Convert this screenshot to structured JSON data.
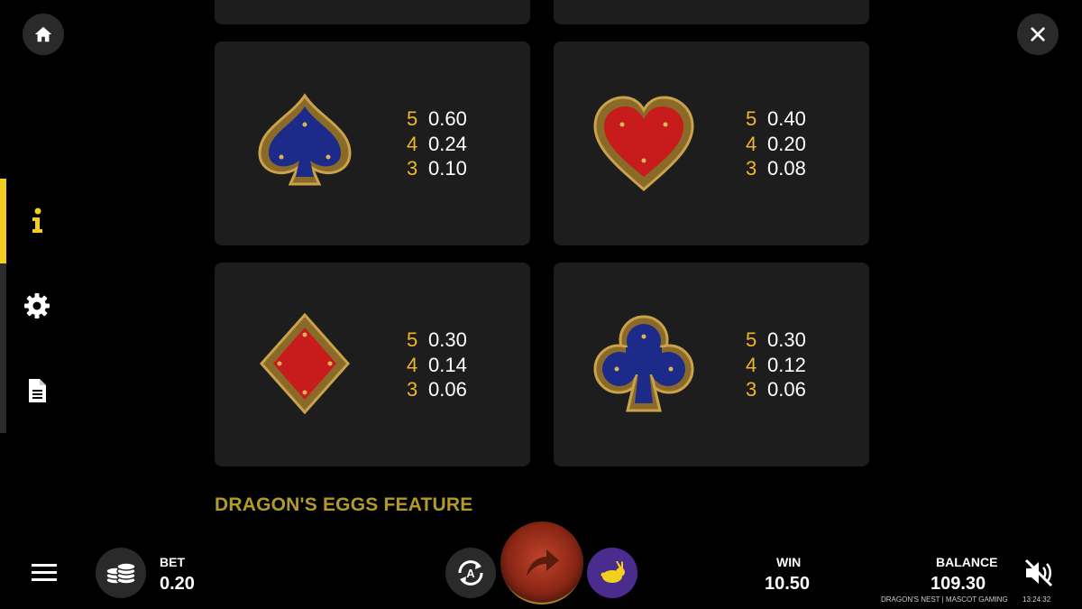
{
  "nav": {
    "home_icon": "home-icon",
    "close_icon": "close-icon",
    "side_items": [
      {
        "name": "info",
        "icon": "info-icon",
        "active": true
      },
      {
        "name": "settings",
        "icon": "gear-icon",
        "active": false
      },
      {
        "name": "rules",
        "icon": "document-icon",
        "active": false
      }
    ],
    "accent_color": "#f2cf1f"
  },
  "paytable": {
    "cards": [
      {
        "symbol": "spade",
        "pays": [
          {
            "count": "5",
            "value": "0.60"
          },
          {
            "count": "4",
            "value": "0.24"
          },
          {
            "count": "3",
            "value": "0.10"
          }
        ]
      },
      {
        "symbol": "heart",
        "pays": [
          {
            "count": "5",
            "value": "0.40"
          },
          {
            "count": "4",
            "value": "0.20"
          },
          {
            "count": "3",
            "value": "0.08"
          }
        ]
      },
      {
        "symbol": "diamond",
        "pays": [
          {
            "count": "5",
            "value": "0.30"
          },
          {
            "count": "4",
            "value": "0.14"
          },
          {
            "count": "3",
            "value": "0.06"
          }
        ]
      },
      {
        "symbol": "club",
        "pays": [
          {
            "count": "5",
            "value": "0.30"
          },
          {
            "count": "4",
            "value": "0.12"
          },
          {
            "count": "3",
            "value": "0.06"
          }
        ]
      }
    ],
    "count_color": "#f0b52a"
  },
  "section_title": "DRAGON'S EGGS FEATURE",
  "bottom_bar": {
    "bet_label": "BET",
    "bet_value": "0.20",
    "win_label": "WIN",
    "win_value": "10.50",
    "balance_label": "BALANCE",
    "balance_value": "109.30",
    "footer_game": "DRAGON'S NEST | MASCOT GAMING",
    "footer_time": "13:24:32"
  }
}
